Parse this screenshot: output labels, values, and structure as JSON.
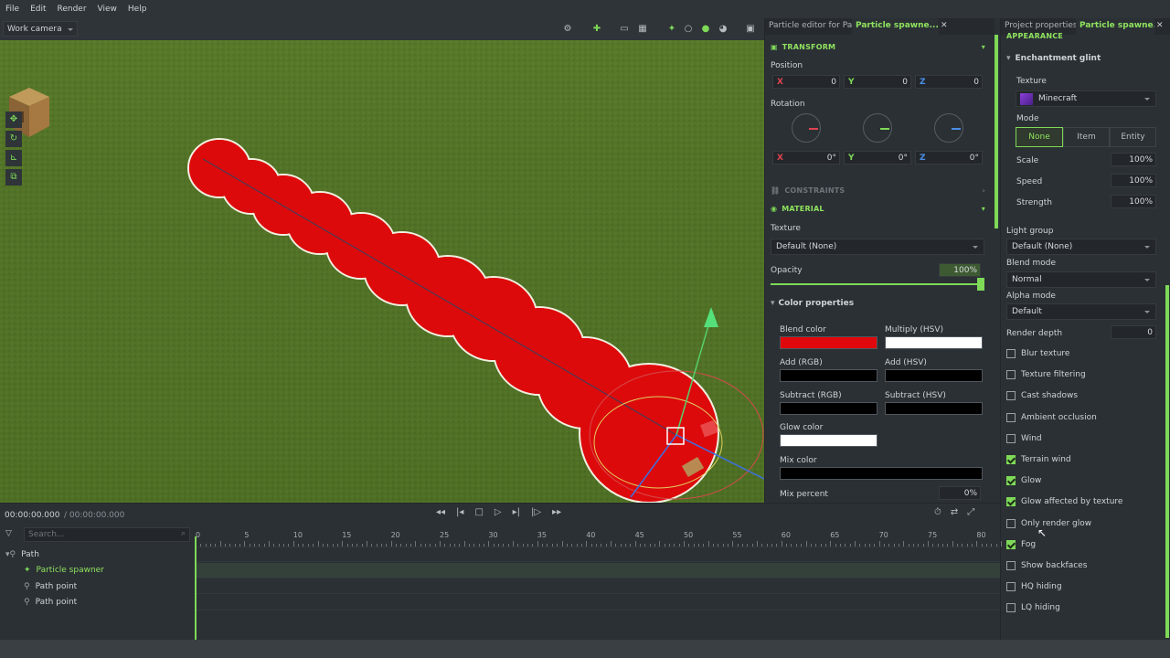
{
  "menu": [
    "File",
    "Edit",
    "Render",
    "View",
    "Help"
  ],
  "viewport": {
    "camera": "Work camera"
  },
  "mid_panel": {
    "tabs": [
      "Particle editor for Pa...",
      "Particle spawne..."
    ],
    "transform": {
      "header": "TRANSFORM",
      "position_label": "Position",
      "position": {
        "x": "0",
        "y": "0",
        "z": "0"
      },
      "rotation_label": "Rotation",
      "rotation": {
        "x": "0°",
        "y": "0°",
        "z": "0°"
      }
    },
    "constraints": "CONSTRAINTS",
    "material": {
      "header": "MATERIAL",
      "texture_label": "Texture",
      "texture_value": "Default (None)",
      "opacity_label": "Opacity",
      "opacity_value": "100%",
      "opacity": 1.0
    },
    "color_props": {
      "header": "Color properties",
      "items": [
        {
          "label": "Blend color",
          "color": "#e0080d"
        },
        {
          "label": "Multiply (HSV)",
          "color": "#ffffff"
        },
        {
          "label": "Add (RGB)",
          "color": "#000000"
        },
        {
          "label": "Add (HSV)",
          "color": "#000000"
        },
        {
          "label": "Subtract (RGB)",
          "color": "#000000"
        },
        {
          "label": "Subtract (HSV)",
          "color": "#000000"
        },
        {
          "label": "Glow color",
          "color": "#ffffff"
        },
        {
          "label": "Mix color",
          "color": "#000000"
        }
      ],
      "mix_percent_label": "Mix percent",
      "mix_percent_value": "0%"
    }
  },
  "right_panel": {
    "tabs": [
      "Project properties",
      "Particle spawne..."
    ],
    "appearance": "APPEARANCE",
    "enchantment": {
      "header": "Enchantment glint",
      "texture_label": "Texture",
      "texture_value": "Minecraft",
      "mode_label": "Mode",
      "modes": [
        "None",
        "Item",
        "Entity"
      ],
      "active_mode": "None",
      "scale_label": "Scale",
      "scale_value": "100%",
      "speed_label": "Speed",
      "speed_value": "100%",
      "strength_label": "Strength",
      "strength_value": "100%"
    },
    "light_group_label": "Light group",
    "light_group_value": "Default (None)",
    "blend_mode_label": "Blend mode",
    "blend_mode_value": "Normal",
    "alpha_mode_label": "Alpha mode",
    "alpha_mode_value": "Default",
    "render_depth_label": "Render depth",
    "render_depth_value": "0",
    "checkboxes": [
      {
        "label": "Blur texture",
        "checked": false
      },
      {
        "label": "Texture filtering",
        "checked": false
      },
      {
        "label": "Cast shadows",
        "checked": false
      },
      {
        "label": "Ambient occlusion",
        "checked": false
      },
      {
        "label": "Wind",
        "checked": false
      },
      {
        "label": "Terrain wind",
        "checked": true
      },
      {
        "label": "Glow",
        "checked": true
      },
      {
        "label": "Glow affected by texture",
        "checked": true
      },
      {
        "label": "Only render glow",
        "checked": false
      },
      {
        "label": "Fog",
        "checked": true
      },
      {
        "label": "Show backfaces",
        "checked": false
      },
      {
        "label": "HQ hiding",
        "checked": false
      },
      {
        "label": "LQ hiding",
        "checked": false
      }
    ]
  },
  "timeline": {
    "time": "00:00:00.000",
    "duration": "/ 00:00:00.000",
    "search_placeholder": "Search...",
    "ticks": [
      "0",
      "5",
      "10",
      "15",
      "20",
      "25",
      "30",
      "35",
      "40",
      "45",
      "50",
      "55",
      "60",
      "65",
      "70",
      "75",
      "80"
    ],
    "tree": [
      {
        "label": "Path",
        "icon": "path-icon"
      },
      {
        "label": "Particle spawner",
        "icon": "particle-spawner-icon"
      },
      {
        "label": "Path point",
        "icon": "path-point-icon"
      },
      {
        "label": "Path point",
        "icon": "path-point-icon"
      }
    ]
  },
  "colors": {
    "accent": "#7ed957",
    "accent_text": "#8fe35e",
    "panel": "#2b3035",
    "blob": "#e00d10"
  }
}
